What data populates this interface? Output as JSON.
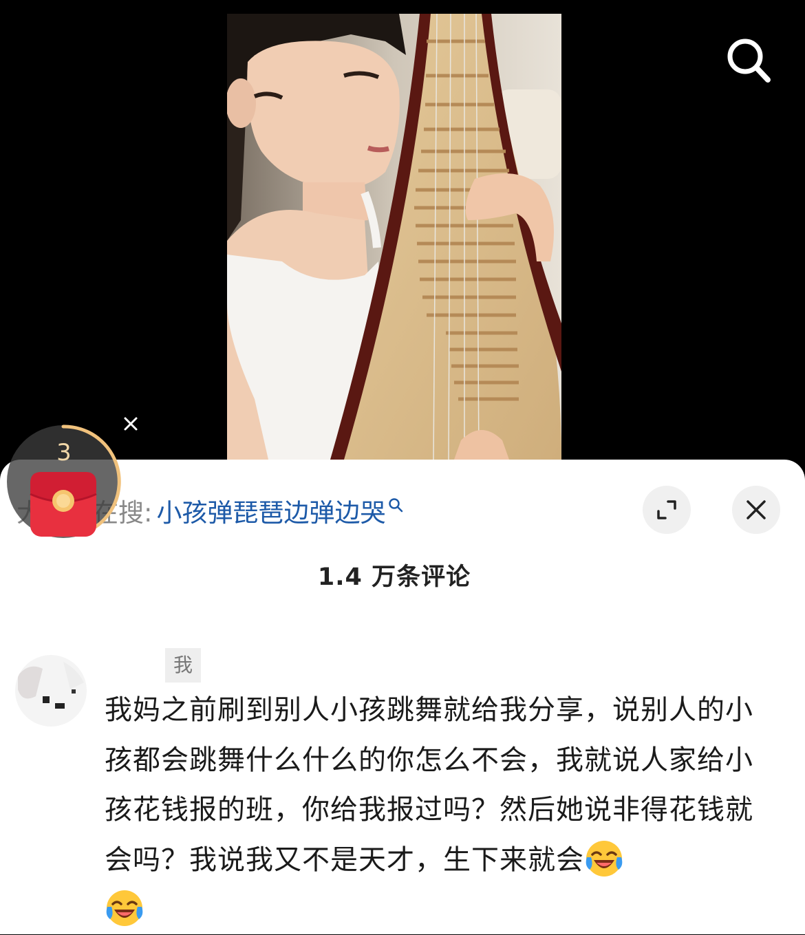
{
  "video": {
    "description_icon": "search-icon",
    "redpacket_count": "3"
  },
  "sheet": {
    "hot_search_prefix": "大家都在搜:",
    "hot_search_query": "小孩弹琵琶边弹边哭",
    "comment_count": "1.4 万条评论"
  },
  "comment": {
    "username": "我",
    "text": "我妈之前刷到别人小孩跳舞就给我分享，说别人的小孩都会跳舞什么什么的你怎么不会，我就说人家给小孩花钱报的班，你给我报过吗？然后她说非得花钱就会吗？我说我又不是天才，生下来就会",
    "emojis": [
      "laughing-crying-emoji",
      "laughing-crying-emoji"
    ]
  },
  "colors": {
    "link_blue": "#1d5aa8",
    "redpacket_red": "#e8303f",
    "ring_gold": "#f1c27d"
  }
}
